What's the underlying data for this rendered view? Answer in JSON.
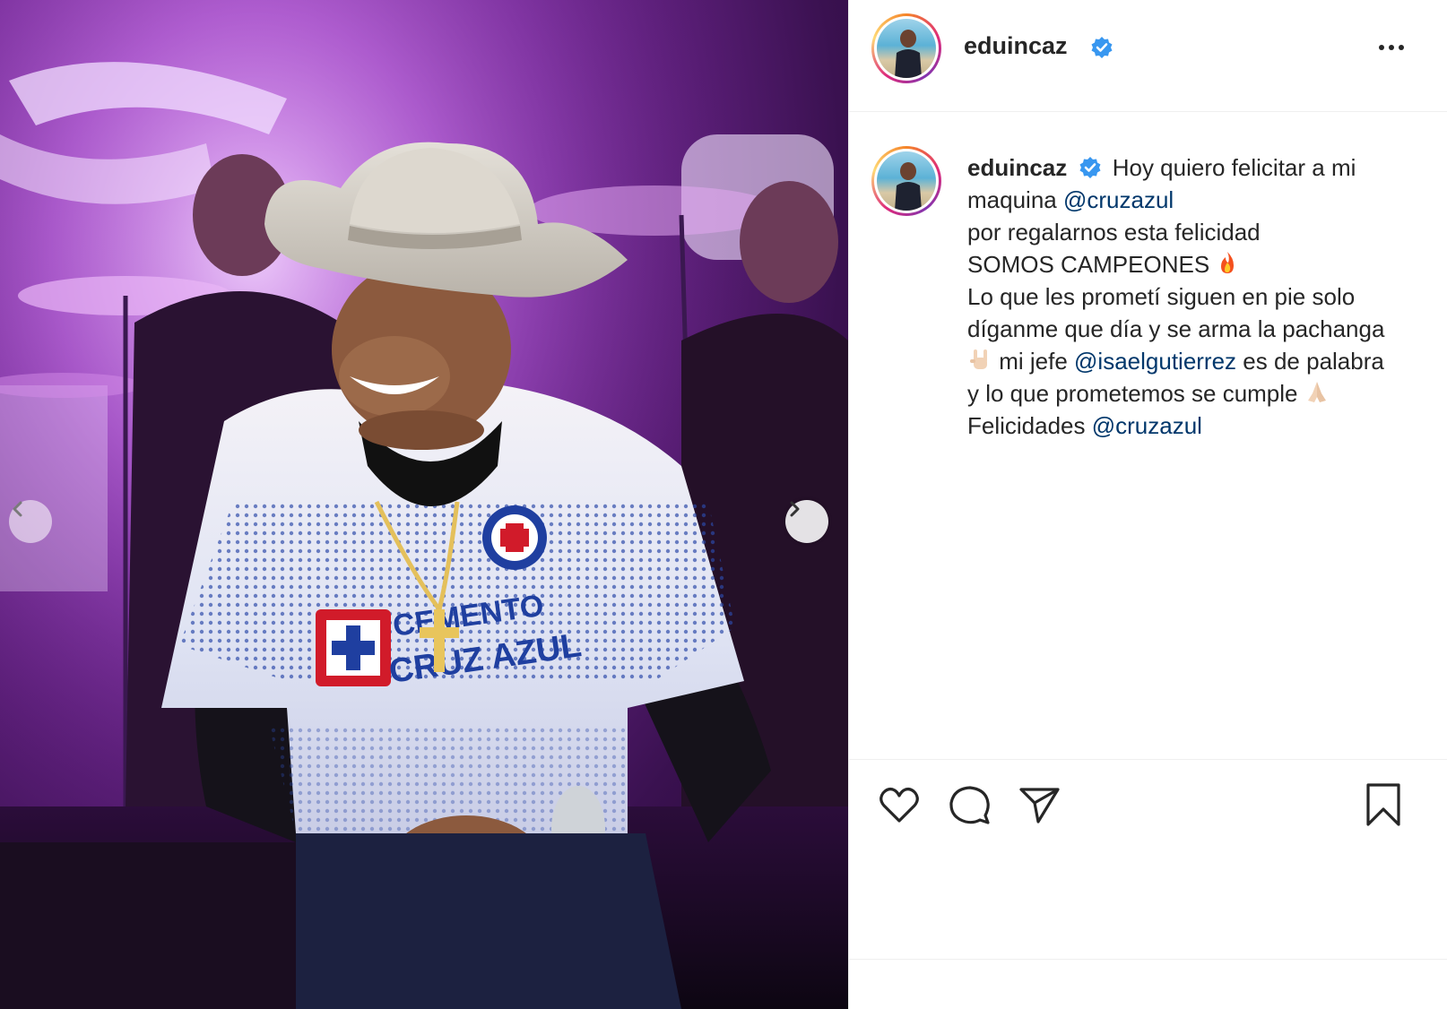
{
  "post": {
    "username": "eduincaz",
    "verified": true,
    "more_label": "More options"
  },
  "caption": {
    "author": "eduincaz",
    "line1_text": "Hoy quiero felicitar a mi",
    "line2_text": "maquina ",
    "line2_mention": "@cruzazul",
    "line3_text": "por regalarnos esta felicidad",
    "line4_text": "SOMOS CAMPEONES ",
    "line4_emoji": "fire",
    "line5_text": "Lo que les prometí siguen en pie solo",
    "line6_text": "díganme que día y se arma la pachanga",
    "line7_emoji": "sign-of-horns",
    "line7_text": " mi jefe ",
    "line7_mention": "@isaelgutierrez",
    "line7_tail": " es de palabra",
    "line8_text": "y lo que prometemos se cumple ",
    "line8_emoji": "folded-hands",
    "line9_text": "Felicidades ",
    "line9_mention": "@cruzazul"
  },
  "media": {
    "jersey_text": "CEMENTO CRUZ AZUL",
    "carousel_prev": "Previous",
    "carousel_next": "Next"
  },
  "actions": {
    "like": "Like",
    "comment": "Comment",
    "share": "Share",
    "save": "Save"
  },
  "colors": {
    "mention": "#00376b",
    "text": "#262626",
    "verified": "#3897f0",
    "stage_purple": "#a743c8"
  }
}
